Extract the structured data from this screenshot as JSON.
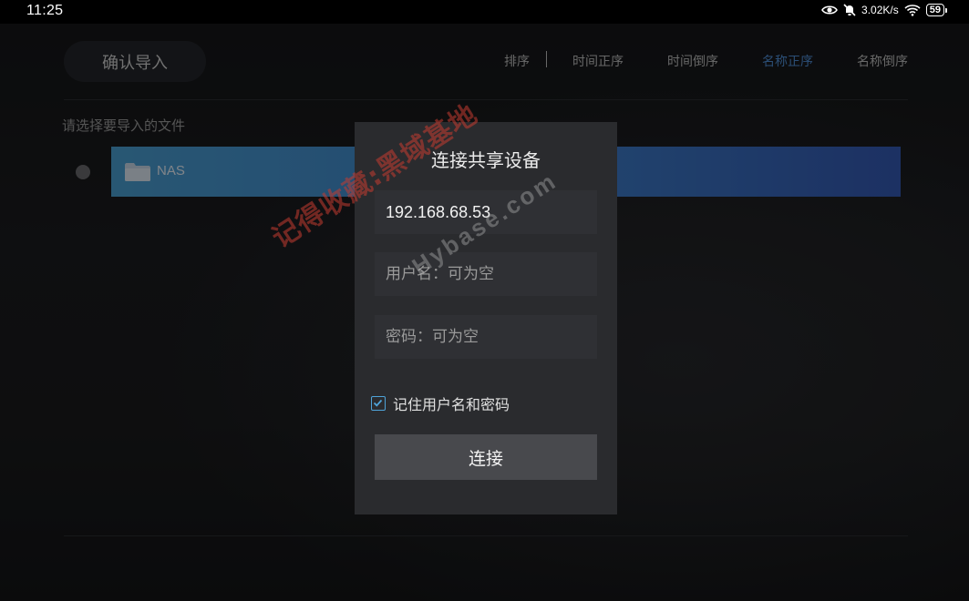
{
  "status_bar": {
    "time": "11:25",
    "network_speed": "3.02K/s",
    "battery": "59"
  },
  "header": {
    "confirm_label": "确认导入",
    "sort": {
      "label": "排序",
      "options": [
        "时间正序",
        "时间倒序",
        "名称正序",
        "名称倒序"
      ],
      "active": "名称正序"
    }
  },
  "file_list": {
    "prompt": "请选择要导入的文件",
    "items": [
      {
        "name": "NAS",
        "type": "folder"
      }
    ]
  },
  "dialog": {
    "title": "连接共享设备",
    "ip_value": "192.168.68.53",
    "username_placeholder": "用户名：可为空",
    "password_placeholder": "密码：可为空",
    "remember_label": "记住用户名和密码",
    "remember_checked": true,
    "connect_label": "连接"
  },
  "watermark": {
    "text": "记得收藏:黑域基地",
    "site": "Hybase.com"
  },
  "colors": {
    "accent": "#4f8fd8",
    "checkbox": "#4fa3d8",
    "row_start": "#4a9fd2",
    "row_end": "#3459b4"
  }
}
